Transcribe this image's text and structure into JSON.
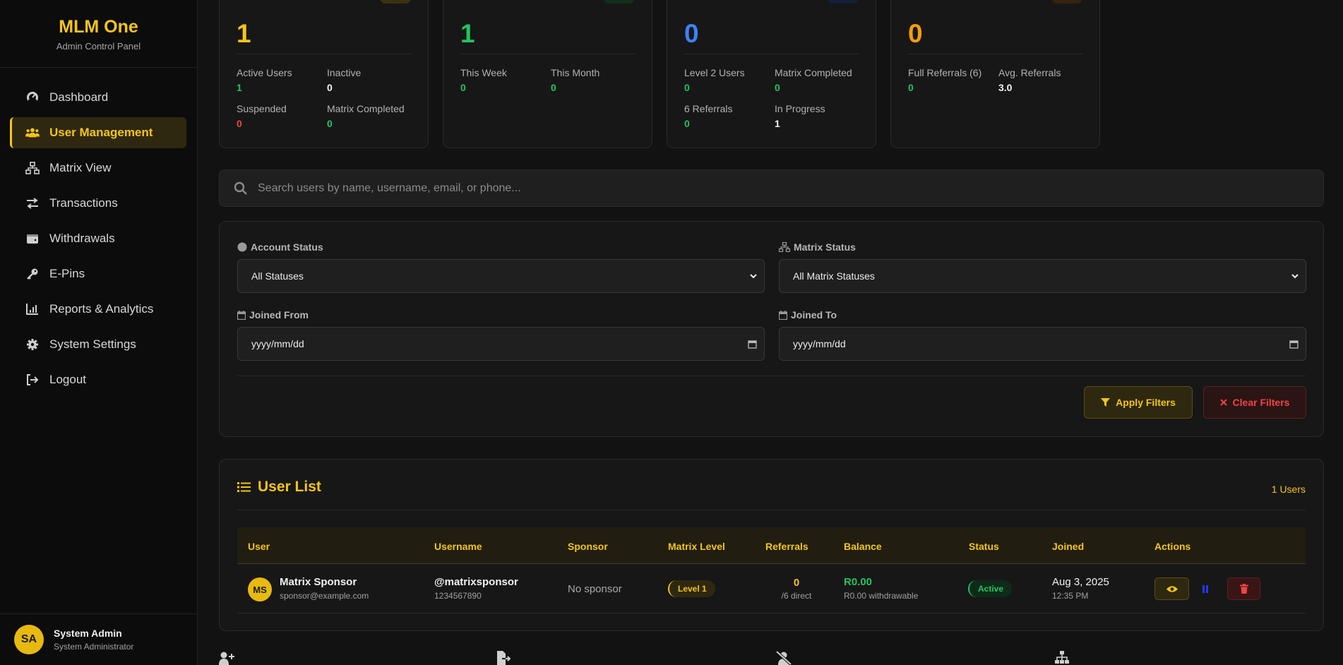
{
  "brand": {
    "title": "MLM One",
    "subtitle": "Admin Control Panel"
  },
  "nav": [
    {
      "label": "Dashboard",
      "icon": "gauge-icon"
    },
    {
      "label": "User Management",
      "icon": "users-icon",
      "active": true
    },
    {
      "label": "Matrix View",
      "icon": "sitemap-icon"
    },
    {
      "label": "Transactions",
      "icon": "exchange-icon"
    },
    {
      "label": "Withdrawals",
      "icon": "wallet-icon"
    },
    {
      "label": "E-Pins",
      "icon": "key-icon"
    },
    {
      "label": "Reports & Analytics",
      "icon": "chart-icon"
    },
    {
      "label": "System Settings",
      "icon": "gear-icon"
    },
    {
      "label": "Logout",
      "icon": "logout-icon"
    }
  ],
  "admin": {
    "initials": "SA",
    "name": "System Admin",
    "role": "System Administrator"
  },
  "stats": [
    {
      "big": "1",
      "color": "#f5c518",
      "items": [
        {
          "label": "Active Users",
          "value": "1",
          "color": "#22c55e"
        },
        {
          "label": "Inactive",
          "value": "0",
          "color": "#f2f2f2"
        },
        {
          "label": "Suspended",
          "value": "0",
          "color": "#ef4444"
        },
        {
          "label": "Matrix Completed",
          "value": "0",
          "color": "#22c55e"
        }
      ]
    },
    {
      "big": "1",
      "color": "#22c55e",
      "items": [
        {
          "label": "This Week",
          "value": "0",
          "color": "#22c55e"
        },
        {
          "label": "This Month",
          "value": "0",
          "color": "#22c55e"
        }
      ]
    },
    {
      "big": "0",
      "color": "#3b82f6",
      "items": [
        {
          "label": "Level 2 Users",
          "value": "0",
          "color": "#22c55e"
        },
        {
          "label": "Matrix Completed",
          "value": "0",
          "color": "#22c55e"
        },
        {
          "label": "6 Referrals",
          "value": "0",
          "color": "#22c55e"
        },
        {
          "label": "In Progress",
          "value": "1",
          "color": "#f2f2f2"
        }
      ]
    },
    {
      "big": "0",
      "color": "#f59e0b",
      "items": [
        {
          "label": "Full Referrals (6)",
          "value": "0",
          "color": "#22c55e"
        },
        {
          "label": "Avg. Referrals",
          "value": "3.0",
          "color": "#f2f2f2"
        }
      ]
    }
  ],
  "search": {
    "placeholder": "Search users by name, username, email, or phone..."
  },
  "filters": {
    "account_status_label": "Account Status",
    "account_status_value": "All Statuses",
    "matrix_status_label": "Matrix Status",
    "matrix_status_value": "All Matrix Statuses",
    "joined_from_label": "Joined From",
    "joined_from_value": "yyyy/mm/dd",
    "joined_to_label": "Joined To",
    "joined_to_value": "yyyy/mm/dd",
    "apply_label": "Apply Filters",
    "clear_label": "Clear Filters"
  },
  "user_list": {
    "title": "User List",
    "count": "1 Users",
    "columns": [
      "User",
      "Username",
      "Sponsor",
      "Matrix Level",
      "Referrals",
      "Balance",
      "Status",
      "Joined",
      "Actions"
    ],
    "rows": [
      {
        "initials": "MS",
        "name": "Matrix Sponsor",
        "email": "sponsor@example.com",
        "username": "@matrixsponsor",
        "phone": "1234567890",
        "sponsor": "No sponsor",
        "level": "Level 1",
        "referrals": "0",
        "referrals_sub": "/6 direct",
        "balance": "R0.00",
        "balance_sub": "R0.00 withdrawable",
        "status": "Active",
        "joined_date": "Aug 3, 2025",
        "joined_time": "12:35 PM"
      }
    ]
  }
}
